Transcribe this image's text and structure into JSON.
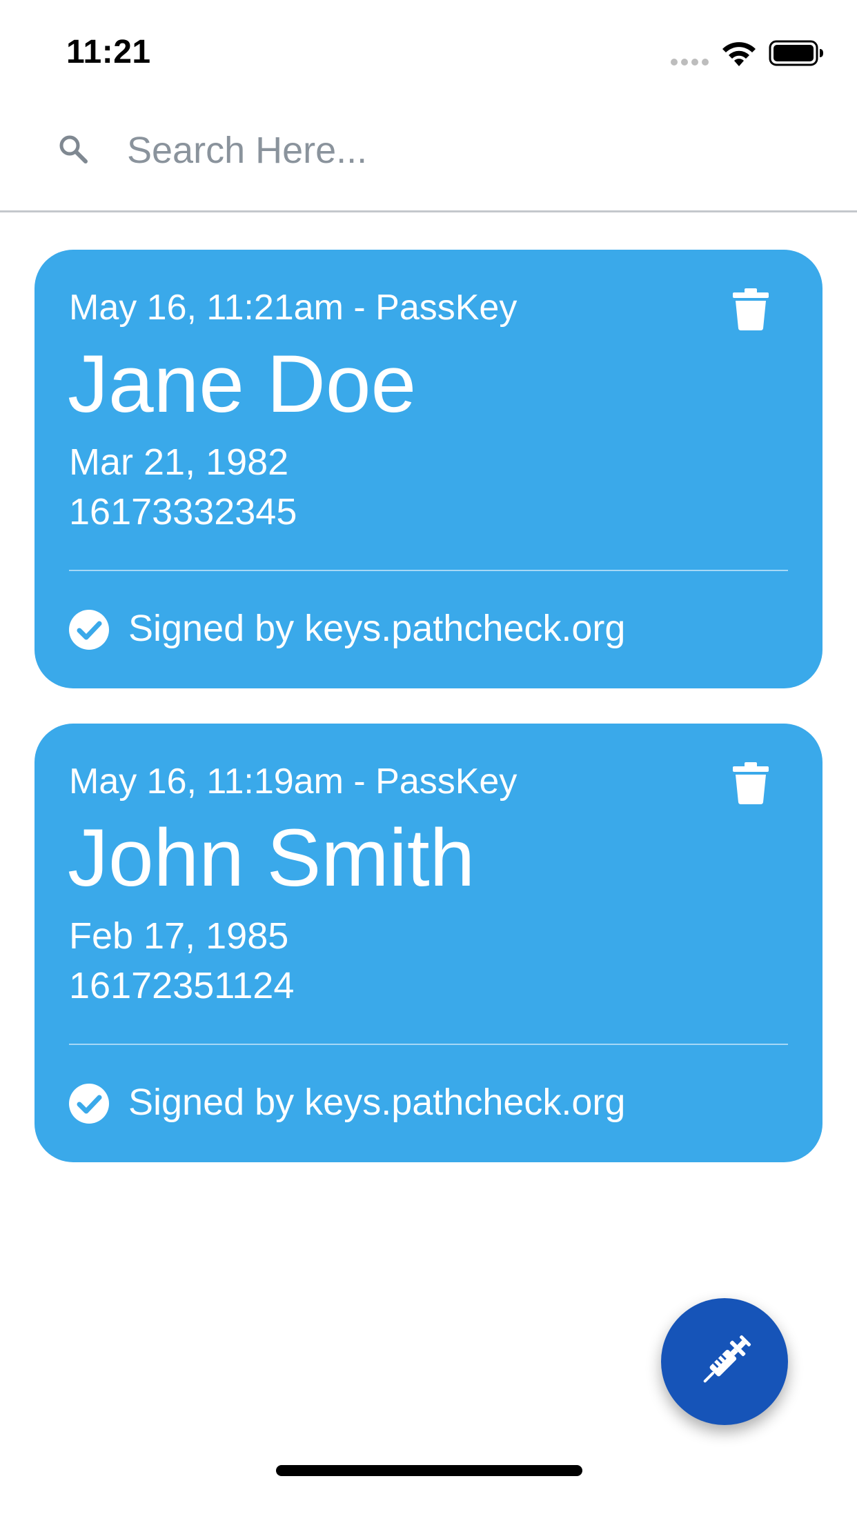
{
  "status_bar": {
    "time": "11:21"
  },
  "search": {
    "placeholder": "Search Here...",
    "value": ""
  },
  "cards": [
    {
      "meta": "May 16, 11:21am - PassKey",
      "name": "Jane Doe",
      "dob": "Mar 21, 1982",
      "phone": "16173332345",
      "signed": "Signed by keys.pathcheck.org"
    },
    {
      "meta": "May 16, 11:19am - PassKey",
      "name": "John Smith",
      "dob": "Feb 17, 1985",
      "phone": "16172351124",
      "signed": "Signed by keys.pathcheck.org"
    }
  ],
  "colors": {
    "card_background": "#3aa9ea",
    "fab_background": "#1654b8",
    "divider": "#c4c7cc",
    "placeholder": "#8a939c"
  },
  "icons": {
    "search": "search-icon",
    "delete": "trash-icon",
    "verified": "check-circle-icon",
    "fab": "syringe-icon",
    "signal": "cellular-signal-icon",
    "wifi": "wifi-icon",
    "battery": "battery-icon"
  }
}
